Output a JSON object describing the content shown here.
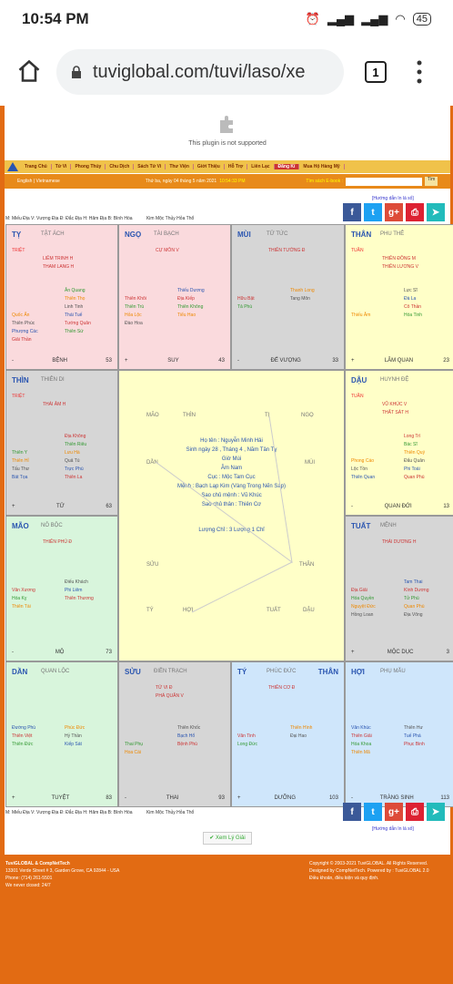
{
  "status": {
    "time": "10:54 PM",
    "battery": "45"
  },
  "browser": {
    "url": "tuviglobal.com/tuvi/laso/xe",
    "tabs": "1"
  },
  "plugin": {
    "text": "This plugin is not supported"
  },
  "nav": [
    "Trang Chủ",
    "Tử Vi",
    "Phong Thủy",
    "Chu Dịch",
    "Sách Tử Vi",
    "Thư Viện",
    "Giới Thiệu",
    "Hỗ Trợ",
    "Liên Lạc",
    "Đăng Kí",
    "Mua Hộ Hàng Mỹ"
  ],
  "subnav": {
    "lang": "English | Vietnamese",
    "date": "Thứ ba, ngày 04 tháng 5 năm 2021",
    "time": "10:54:33 PM",
    "ebook": "Tìm sách E-book :",
    "search": "Tìm"
  },
  "guide": "[Hướng dẫn In lá số]",
  "legend": "M: Miếu Địa  V: Vượng Địa  Đ: Đắc Địa  H: Hãm Địa  B: Bình Hòa",
  "legend2": "Kim  Mộc  Thủy  Hỏa  Thổ",
  "cells": [
    {
      "name": "TỴ",
      "palace": "TẬT ÁCH",
      "stars": [
        "TRIỆT",
        "LIÊM TRINH H",
        "THAM LANG H",
        "Quốc Ấn",
        "Thiên Phúc",
        "Phượng Các",
        "Giải Thần",
        "Ân Quang",
        "Thiên Thọ",
        "Linh Tinh",
        "Thái Tuế",
        "Tướng Quân",
        "Thiên Sứ"
      ],
      "bl": "-",
      "bc": "BỆNH",
      "br": "53"
    },
    {
      "name": "NGỌ",
      "palace": "TÀI BẠCH",
      "stars": [
        "CỰ MÔN V",
        "Thiên Khôi",
        "Thiên Trù",
        "Hỏa Lộc",
        "Đào Hoa",
        "Thiếu Dương",
        "Địa Kiếp",
        "Thiên Không",
        "Tiểu Hao"
      ],
      "bl": "+",
      "bc": "SUY",
      "br": "43"
    },
    {
      "name": "MÙI",
      "palace": "TỬ TỨC",
      "stars": [
        "THIÊN TƯỚNG Đ",
        "Hữu Bật",
        "Tả Phù",
        "Thanh Long",
        "Tang Môn"
      ],
      "bl": "-",
      "bc": "ĐẾ VƯỢNG",
      "br": "33"
    },
    {
      "name": "THÂN",
      "palace": "PHU THÊ",
      "stars": [
        "TUẦN",
        "THIÊN ĐỒNG M",
        "THIÊN LƯƠNG V",
        "Thiếu Âm",
        "Lực Sĩ",
        "Đà La",
        "Cô Thần",
        "Hóa Tinh"
      ],
      "bl": "+",
      "bc": "LÂM QUAN",
      "br": "23"
    },
    {
      "name": "THÌN",
      "palace": "THIÊN DI",
      "stars": [
        "TRIỆT",
        "THÁI ÂM H",
        "Thiên Y",
        "Thiên Hỉ",
        "Tấu Thư",
        "Bát Tọa",
        "Địa Không",
        "Thiên Riêu",
        "Lưu Hà",
        "Quả Tú",
        "Trực Phù",
        "Thiên La"
      ],
      "bl": "+",
      "bc": "TỬ",
      "br": "63"
    },
    {
      "name": "DẬU",
      "palace": "HUYNH ĐỆ",
      "stars": [
        "TUẦN",
        "VŨ KHÚC V",
        "THẤT SÁT H",
        "Phong Cáo",
        "Lộc Tồn",
        "Thiên Quan",
        "Long Trì",
        "Bác Sĩ",
        "Thiên Quý",
        "Đẩu Quân",
        "Phi Toái",
        "Quan Phù"
      ],
      "bl": "-",
      "bc": "QUAN ĐỚI",
      "br": "13"
    },
    {
      "name": "MÃO",
      "palace": "NÔ BỘC",
      "stars": [
        "THIÊN PHỦ Đ",
        "Văn Xương",
        "Hóa Kỵ",
        "Thiên Tài",
        "Điếu Khách",
        "Phi Liêm",
        "Thiên Thương"
      ],
      "bl": "-",
      "bc": "MỘ",
      "br": "73"
    },
    {
      "name": "TUẤT",
      "palace": "MỆNH",
      "stars": [
        "THÁI DƯƠNG H",
        "Địa Giải",
        "Hóa Quyền",
        "Nguyệt Đức",
        "Hồng Loan",
        "Tam Thai",
        "Kình Dương",
        "Tử Phù",
        "Quan Phù",
        "Địa Võng"
      ],
      "bl": "+",
      "bc": "MỘC DỤC",
      "br": "3"
    },
    {
      "name": "DẦN",
      "palace": "QUAN LỘC",
      "stars": [
        "Đường Phù",
        "Thiên Việt",
        "Thiên Đức",
        "Phúc Đức",
        "Hỷ Thần",
        "Kiếp Sát"
      ],
      "bl": "+",
      "bc": "TUYỆT",
      "br": "83"
    },
    {
      "name": "SỬU",
      "palace": "ĐIỀN TRẠCH",
      "stars": [
        "TỬ VI Đ",
        "PHÁ QUÂN V",
        "Thai Phụ",
        "Hoa Cái",
        "Thiên Khốc",
        "Bạch Hổ",
        "Bệnh Phù"
      ],
      "bl": "-",
      "bc": "THAI",
      "br": "93"
    },
    {
      "name": "TÝ",
      "palace": "PHÚC ĐỨC",
      "extra": "THÂN",
      "stars": [
        "THIÊN CƠ Đ",
        "Văn Tinh",
        "Long Đức",
        "Thiên Hình",
        "Đại Hao"
      ],
      "bl": "+",
      "bc": "DƯỠNG",
      "br": "103"
    },
    {
      "name": "HỢI",
      "palace": "PHỤ MẪU",
      "stars": [
        "Văn Khúc",
        "Thiên Giải",
        "Hóa Khoa",
        "Thiên Mã",
        "Thiên Hư",
        "Tuế Phá",
        "Phục Binh"
      ],
      "bl": "-",
      "bc": "TRÀNG SINH",
      "br": "113"
    }
  ],
  "center": {
    "name": "Họ tên : Nguyễn Minh Hải",
    "birth": "Sinh ngày 28 , Tháng 4 , Năm Tân Tỵ",
    "hour": "Giờ Mùi",
    "sex": "Âm Nam",
    "cuc": "Cục : Mộc Tam Cục",
    "menh": "Mệnh : Bạch Lạp Kim (Vàng Trong Nến Sáp)",
    "chu_menh": "Sao chủ mệnh : Vũ Khúc",
    "chu_than": "Sao chủ thân : Thiên Cơ",
    "luong": "Lượng Chỉ : 3 Lượng 1 Chỉ",
    "labels": [
      "MÃO",
      "THÌN",
      "TỊ",
      "NGỌ",
      "DẦN",
      "MÙI",
      "SỬU",
      "THÂN",
      "TÝ",
      "HỢI",
      "TUẤT",
      "DẬU"
    ]
  },
  "button": "Xem Lý Giải",
  "footer": {
    "left1": "TuviGLOBAL & CompNetTech",
    "left2": "13301 Verde Street # 3, Garden Grove, CA 92844 - USA",
    "left3": "Phone: (714) 261-5501",
    "left4": "We never closed: 24/7",
    "right1": "Copyright © 2003-2021 TuviGLOBAL. All Rights Reserved.",
    "right2": "Designed by CompNetTech. Powered by : TuviGLOBAL 2.0",
    "right3": "Điều khoản, điều kiện và quy định."
  }
}
